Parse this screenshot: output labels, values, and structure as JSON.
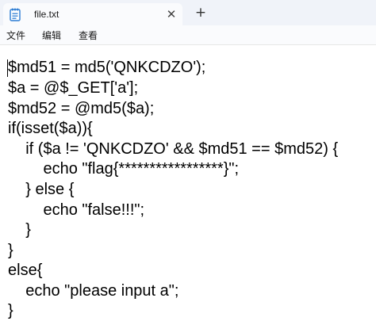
{
  "tab": {
    "title": "file.txt",
    "close_glyph": "✕",
    "icon": "notepad-file-icon"
  },
  "new_tab_glyph": "+",
  "menu": {
    "file": "文件",
    "edit": "编辑",
    "view": "查看"
  },
  "editor": {
    "lines": [
      "$md51 = md5('QNKCDZO');",
      "$a = @$_GET['a'];",
      "$md52 = @md5($a);",
      "if(isset($a)){",
      "    if ($a != 'QNKCDZO' && $md51 == $md52) {",
      "        echo \"flag{*****************}\";",
      "    } else {",
      "        echo \"false!!!\";",
      "    }",
      "}",
      "else{",
      "    echo \"please input a\";",
      "}"
    ]
  },
  "colors": {
    "tabbar_bg": "#f0f3f9",
    "tab_bg": "#fafbfd",
    "icon_blue": "#2b7cd3",
    "text": "#000000"
  }
}
